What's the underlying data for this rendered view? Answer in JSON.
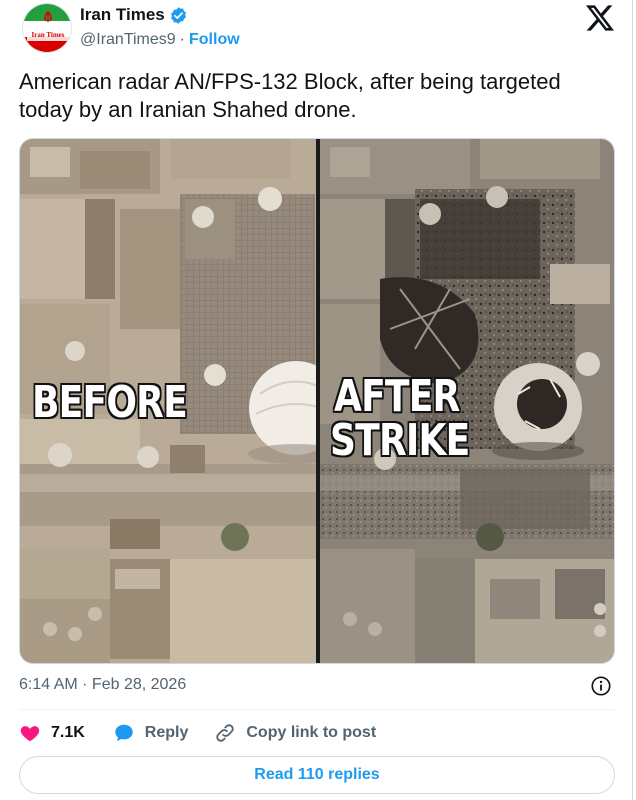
{
  "tweet": {
    "author": {
      "display_name": "Iran Times",
      "handle": "@IranTimes9",
      "separator": "·",
      "follow_label": "Follow",
      "avatar_text": "Iran Times",
      "verified": true
    },
    "text": "American radar AN/FPS-132 Block, after being targeted today by an Iranian Shahed drone.",
    "media": {
      "label_before": "BEFORE",
      "label_after_line1": "AFTER",
      "label_after_line2": "STRIKE"
    },
    "timestamp": "6:14 AM · Feb 28, 2026",
    "actions": {
      "likes": "7.1K",
      "reply_label": "Reply",
      "copy_link_label": "Copy link to post"
    },
    "read_replies_label": "Read 110 replies"
  },
  "icons": {
    "brand": "x-logo-icon",
    "verified": "verified-badge-icon",
    "info": "info-icon",
    "like": "heart-icon",
    "reply": "speech-bubble-icon",
    "copy": "link-icon"
  },
  "colors": {
    "accent": "#1d9bf0",
    "like": "#f91880",
    "text_primary": "#0f1419",
    "text_secondary": "#536471",
    "border": "#cfd9de"
  }
}
